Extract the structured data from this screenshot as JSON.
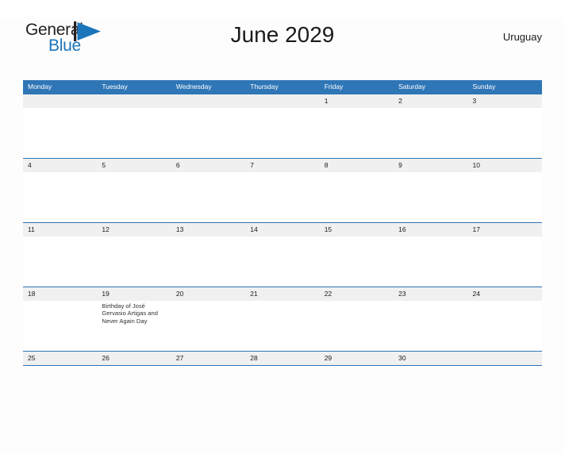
{
  "brand": {
    "word_general": "General",
    "word_blue": "Blue",
    "flag_color": "#1b75bb",
    "pole_color": "#231f20"
  },
  "header": {
    "title": "June 2029",
    "country": "Uruguay",
    "accent_color": "#2f76b6",
    "date_row_bg": "#f0f0f0"
  },
  "calendar": {
    "weekday_headers": [
      "Monday",
      "Tuesday",
      "Wednesday",
      "Thursday",
      "Friday",
      "Saturday",
      "Sunday"
    ],
    "weeks": [
      {
        "dates": [
          "",
          "",
          "",
          "",
          "1",
          "2",
          "3"
        ],
        "events": [
          "",
          "",
          "",
          "",
          "",
          "",
          ""
        ]
      },
      {
        "dates": [
          "4",
          "5",
          "6",
          "7",
          "8",
          "9",
          "10"
        ],
        "events": [
          "",
          "",
          "",
          "",
          "",
          "",
          ""
        ]
      },
      {
        "dates": [
          "11",
          "12",
          "13",
          "14",
          "15",
          "16",
          "17"
        ],
        "events": [
          "",
          "",
          "",
          "",
          "",
          "",
          ""
        ]
      },
      {
        "dates": [
          "18",
          "19",
          "20",
          "21",
          "22",
          "23",
          "24"
        ],
        "events": [
          "",
          "Birthday of José Gervasio Artigas and Never Again Day",
          "",
          "",
          "",
          "",
          ""
        ]
      },
      {
        "dates": [
          "25",
          "26",
          "27",
          "28",
          "29",
          "30",
          ""
        ],
        "events": [
          "",
          "",
          "",
          "",
          "",
          "",
          ""
        ]
      }
    ]
  }
}
